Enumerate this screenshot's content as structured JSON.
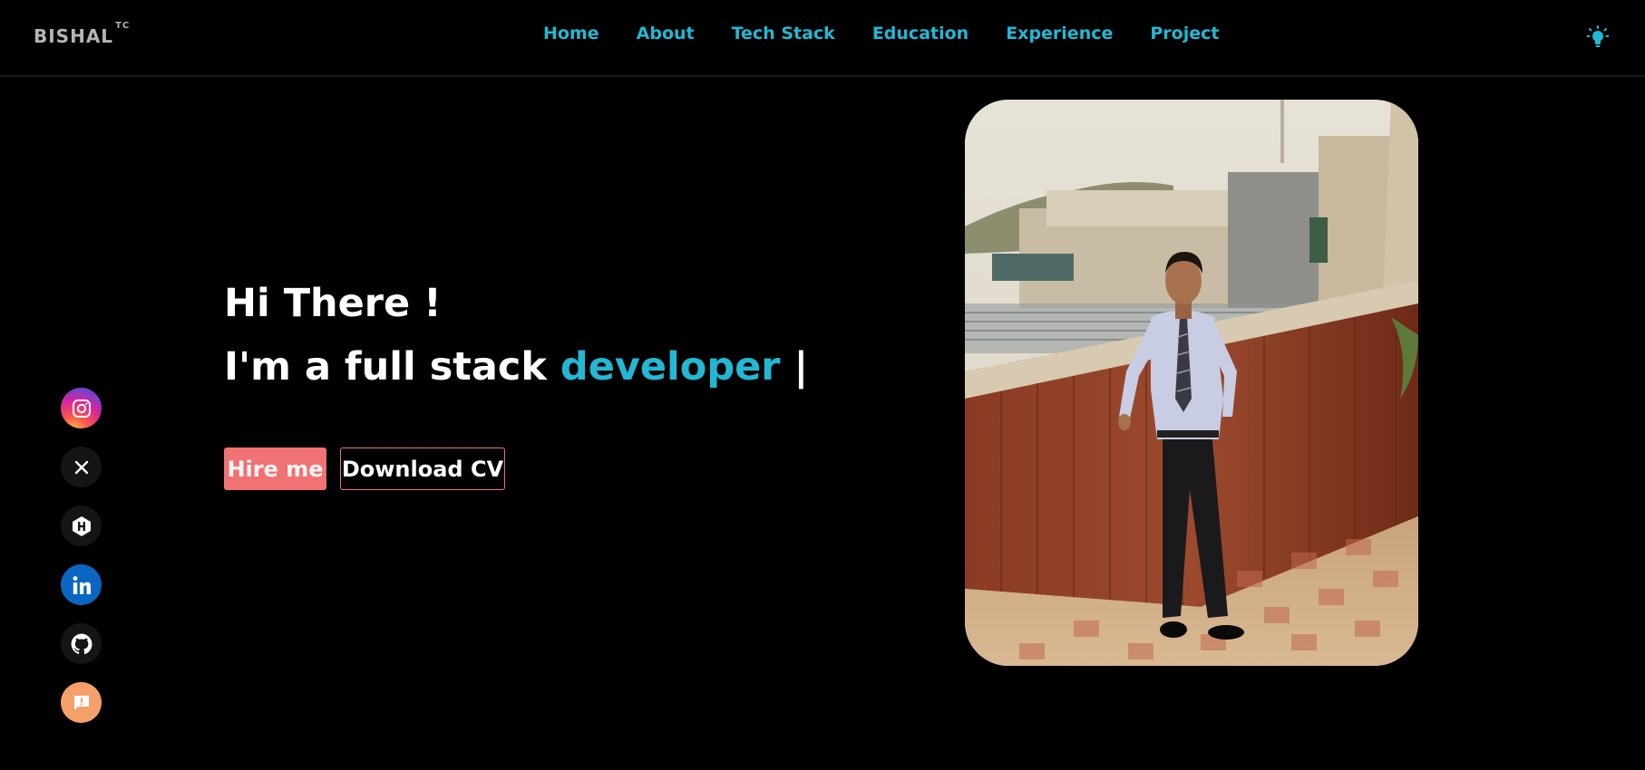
{
  "header": {
    "logo": "BISHAL",
    "logo_mark": "TC",
    "nav": [
      {
        "label": "Home"
      },
      {
        "label": "About"
      },
      {
        "label": "Tech Stack"
      },
      {
        "label": "Education"
      },
      {
        "label": "Experience"
      },
      {
        "label": "Project"
      }
    ],
    "theme_toggle_icon": "lightbulb-icon"
  },
  "hero": {
    "greeting": "Hi There !",
    "role_prefix": "I'm a full stack ",
    "role_accent": "developer",
    "cursor": " |",
    "hire_label": "Hire me",
    "cv_label": "Download CV"
  },
  "social": [
    {
      "name": "instagram-icon"
    },
    {
      "name": "x-icon"
    },
    {
      "name": "hashnode-icon"
    },
    {
      "name": "linkedin-icon"
    },
    {
      "name": "github-icon"
    },
    {
      "name": "feedback-icon"
    }
  ],
  "colors": {
    "accent": "#22b8d4",
    "button": "#f07272",
    "background": "#000000"
  }
}
